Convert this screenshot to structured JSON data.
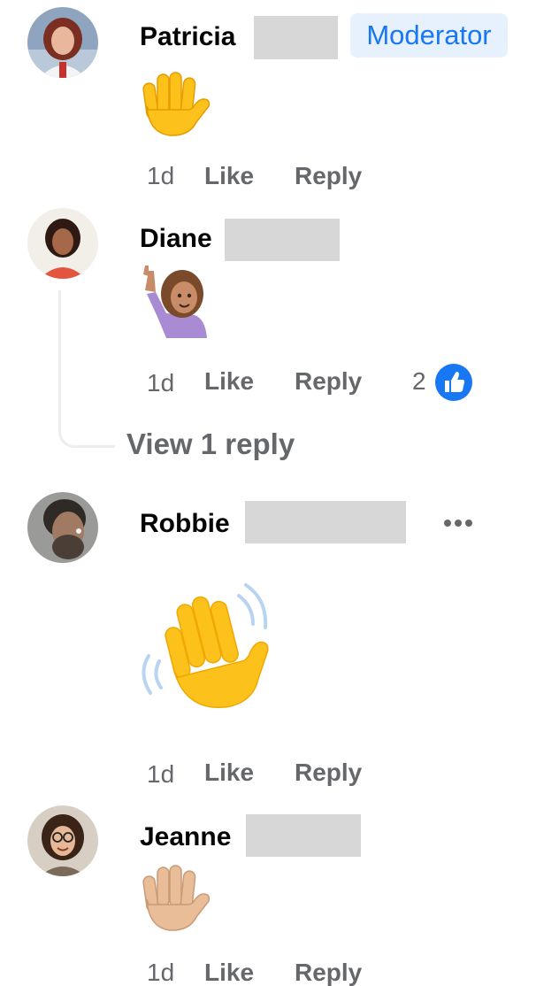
{
  "comments": [
    {
      "name": "Patricia",
      "badge": "Moderator",
      "emoji": "raised-hand-yellow",
      "time": "1d",
      "like_label": "Like",
      "reply_label": "Reply"
    },
    {
      "name": "Diane",
      "emoji": "person-raising-hand",
      "time": "1d",
      "like_label": "Like",
      "reply_label": "Reply",
      "reaction_count": "2",
      "reaction_icon": "thumbs-up-icon",
      "view_replies": "View 1 reply"
    },
    {
      "name": "Robbie",
      "emoji": "waving-hand-yellow",
      "time": "1d",
      "like_label": "Like",
      "reply_label": "Reply",
      "more_icon": "more-options-icon"
    },
    {
      "name": "Jeanne",
      "emoji": "raised-hand-light-skin",
      "time": "1d",
      "like_label": "Like",
      "reply_label": "Reply"
    }
  ],
  "colors": {
    "name_text": "#050505",
    "meta_text": "#65676b",
    "brand_blue": "#1877f2",
    "badge_bg": "#e7f1fd",
    "redaction": "#d7d7d7"
  }
}
